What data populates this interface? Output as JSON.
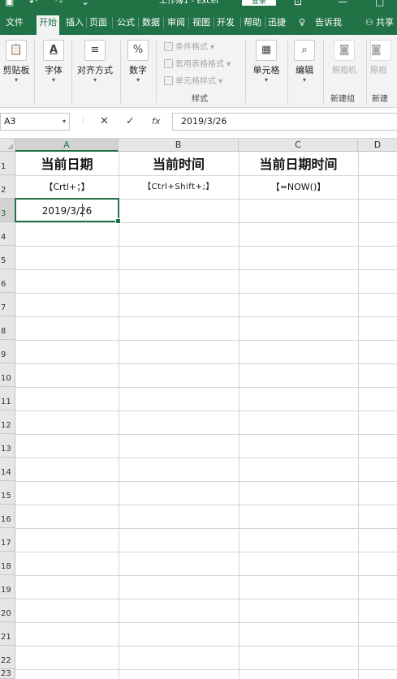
{
  "window": {
    "title": "工作簿1 - Excel",
    "login_label": "登录"
  },
  "tabs": [
    {
      "label": "文件"
    },
    {
      "label": "开始"
    },
    {
      "label": "插入"
    },
    {
      "label": "页面"
    },
    {
      "label": "公式"
    },
    {
      "label": "数据"
    },
    {
      "label": "审阅"
    },
    {
      "label": "视图"
    },
    {
      "label": "开发"
    },
    {
      "label": "帮助"
    },
    {
      "label": "迅捷"
    },
    {
      "label": "告诉我"
    },
    {
      "label": "共享"
    }
  ],
  "ribbon": {
    "clipboard": "剪贴板",
    "font": "字体",
    "alignment": "对齐方式",
    "number": "数字",
    "conditional_format": "条件格式",
    "table_format": "套用表格格式",
    "cell_style": "单元格样式",
    "styles_group": "样式",
    "cells": "单元格",
    "editing": "编辑",
    "camera": "照相机",
    "camera2": "照相",
    "new_group": "新建组",
    "new_group2": "新建"
  },
  "formula_bar": {
    "name_box": "A3",
    "formula": "2019/3/26"
  },
  "grid": {
    "columns": [
      "A",
      "B",
      "C",
      "D"
    ],
    "rows": [
      "1",
      "2",
      "3",
      "4",
      "5",
      "6",
      "7",
      "8",
      "9",
      "10",
      "11",
      "12",
      "13",
      "14",
      "15",
      "16",
      "17",
      "18",
      "19",
      "20",
      "21",
      "22",
      "23"
    ],
    "cells": {
      "A1": "当前日期",
      "B1": "当前时间",
      "C1": "当前日期时间",
      "A2": "【Crtl+；】",
      "B2": "【Ctrl+Shift+;】",
      "C2": "【=NOW()】",
      "A3": "2019/3/26"
    }
  },
  "colors": {
    "accent": "#217346"
  }
}
